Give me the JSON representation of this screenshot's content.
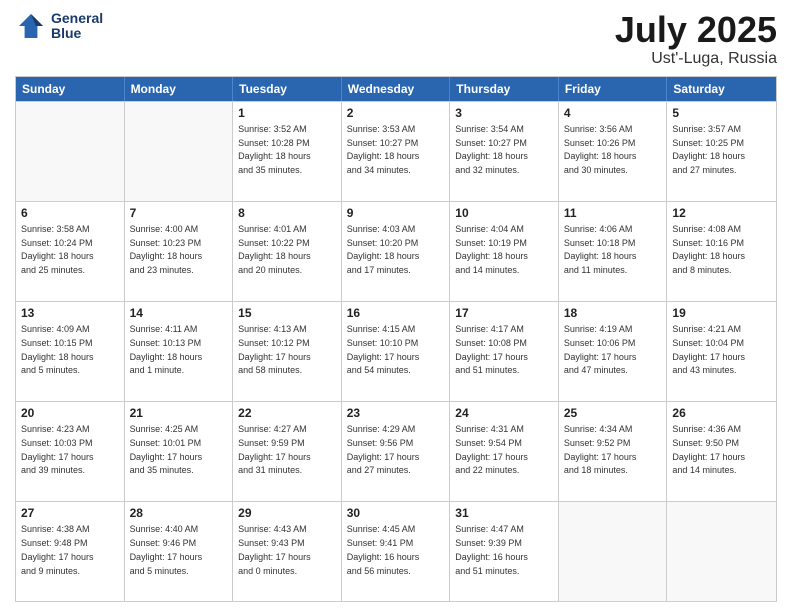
{
  "header": {
    "logo_line1": "General",
    "logo_line2": "Blue",
    "month": "July 2025",
    "location": "Ust'-Luga, Russia"
  },
  "weekdays": [
    "Sunday",
    "Monday",
    "Tuesday",
    "Wednesday",
    "Thursday",
    "Friday",
    "Saturday"
  ],
  "weeks": [
    [
      {
        "day": "",
        "info": ""
      },
      {
        "day": "",
        "info": ""
      },
      {
        "day": "1",
        "info": "Sunrise: 3:52 AM\nSunset: 10:28 PM\nDaylight: 18 hours\nand 35 minutes."
      },
      {
        "day": "2",
        "info": "Sunrise: 3:53 AM\nSunset: 10:27 PM\nDaylight: 18 hours\nand 34 minutes."
      },
      {
        "day": "3",
        "info": "Sunrise: 3:54 AM\nSunset: 10:27 PM\nDaylight: 18 hours\nand 32 minutes."
      },
      {
        "day": "4",
        "info": "Sunrise: 3:56 AM\nSunset: 10:26 PM\nDaylight: 18 hours\nand 30 minutes."
      },
      {
        "day": "5",
        "info": "Sunrise: 3:57 AM\nSunset: 10:25 PM\nDaylight: 18 hours\nand 27 minutes."
      }
    ],
    [
      {
        "day": "6",
        "info": "Sunrise: 3:58 AM\nSunset: 10:24 PM\nDaylight: 18 hours\nand 25 minutes."
      },
      {
        "day": "7",
        "info": "Sunrise: 4:00 AM\nSunset: 10:23 PM\nDaylight: 18 hours\nand 23 minutes."
      },
      {
        "day": "8",
        "info": "Sunrise: 4:01 AM\nSunset: 10:22 PM\nDaylight: 18 hours\nand 20 minutes."
      },
      {
        "day": "9",
        "info": "Sunrise: 4:03 AM\nSunset: 10:20 PM\nDaylight: 18 hours\nand 17 minutes."
      },
      {
        "day": "10",
        "info": "Sunrise: 4:04 AM\nSunset: 10:19 PM\nDaylight: 18 hours\nand 14 minutes."
      },
      {
        "day": "11",
        "info": "Sunrise: 4:06 AM\nSunset: 10:18 PM\nDaylight: 18 hours\nand 11 minutes."
      },
      {
        "day": "12",
        "info": "Sunrise: 4:08 AM\nSunset: 10:16 PM\nDaylight: 18 hours\nand 8 minutes."
      }
    ],
    [
      {
        "day": "13",
        "info": "Sunrise: 4:09 AM\nSunset: 10:15 PM\nDaylight: 18 hours\nand 5 minutes."
      },
      {
        "day": "14",
        "info": "Sunrise: 4:11 AM\nSunset: 10:13 PM\nDaylight: 18 hours\nand 1 minute."
      },
      {
        "day": "15",
        "info": "Sunrise: 4:13 AM\nSunset: 10:12 PM\nDaylight: 17 hours\nand 58 minutes."
      },
      {
        "day": "16",
        "info": "Sunrise: 4:15 AM\nSunset: 10:10 PM\nDaylight: 17 hours\nand 54 minutes."
      },
      {
        "day": "17",
        "info": "Sunrise: 4:17 AM\nSunset: 10:08 PM\nDaylight: 17 hours\nand 51 minutes."
      },
      {
        "day": "18",
        "info": "Sunrise: 4:19 AM\nSunset: 10:06 PM\nDaylight: 17 hours\nand 47 minutes."
      },
      {
        "day": "19",
        "info": "Sunrise: 4:21 AM\nSunset: 10:04 PM\nDaylight: 17 hours\nand 43 minutes."
      }
    ],
    [
      {
        "day": "20",
        "info": "Sunrise: 4:23 AM\nSunset: 10:03 PM\nDaylight: 17 hours\nand 39 minutes."
      },
      {
        "day": "21",
        "info": "Sunrise: 4:25 AM\nSunset: 10:01 PM\nDaylight: 17 hours\nand 35 minutes."
      },
      {
        "day": "22",
        "info": "Sunrise: 4:27 AM\nSunset: 9:59 PM\nDaylight: 17 hours\nand 31 minutes."
      },
      {
        "day": "23",
        "info": "Sunrise: 4:29 AM\nSunset: 9:56 PM\nDaylight: 17 hours\nand 27 minutes."
      },
      {
        "day": "24",
        "info": "Sunrise: 4:31 AM\nSunset: 9:54 PM\nDaylight: 17 hours\nand 22 minutes."
      },
      {
        "day": "25",
        "info": "Sunrise: 4:34 AM\nSunset: 9:52 PM\nDaylight: 17 hours\nand 18 minutes."
      },
      {
        "day": "26",
        "info": "Sunrise: 4:36 AM\nSunset: 9:50 PM\nDaylight: 17 hours\nand 14 minutes."
      }
    ],
    [
      {
        "day": "27",
        "info": "Sunrise: 4:38 AM\nSunset: 9:48 PM\nDaylight: 17 hours\nand 9 minutes."
      },
      {
        "day": "28",
        "info": "Sunrise: 4:40 AM\nSunset: 9:46 PM\nDaylight: 17 hours\nand 5 minutes."
      },
      {
        "day": "29",
        "info": "Sunrise: 4:43 AM\nSunset: 9:43 PM\nDaylight: 17 hours\nand 0 minutes."
      },
      {
        "day": "30",
        "info": "Sunrise: 4:45 AM\nSunset: 9:41 PM\nDaylight: 16 hours\nand 56 minutes."
      },
      {
        "day": "31",
        "info": "Sunrise: 4:47 AM\nSunset: 9:39 PM\nDaylight: 16 hours\nand 51 minutes."
      },
      {
        "day": "",
        "info": ""
      },
      {
        "day": "",
        "info": ""
      }
    ]
  ]
}
